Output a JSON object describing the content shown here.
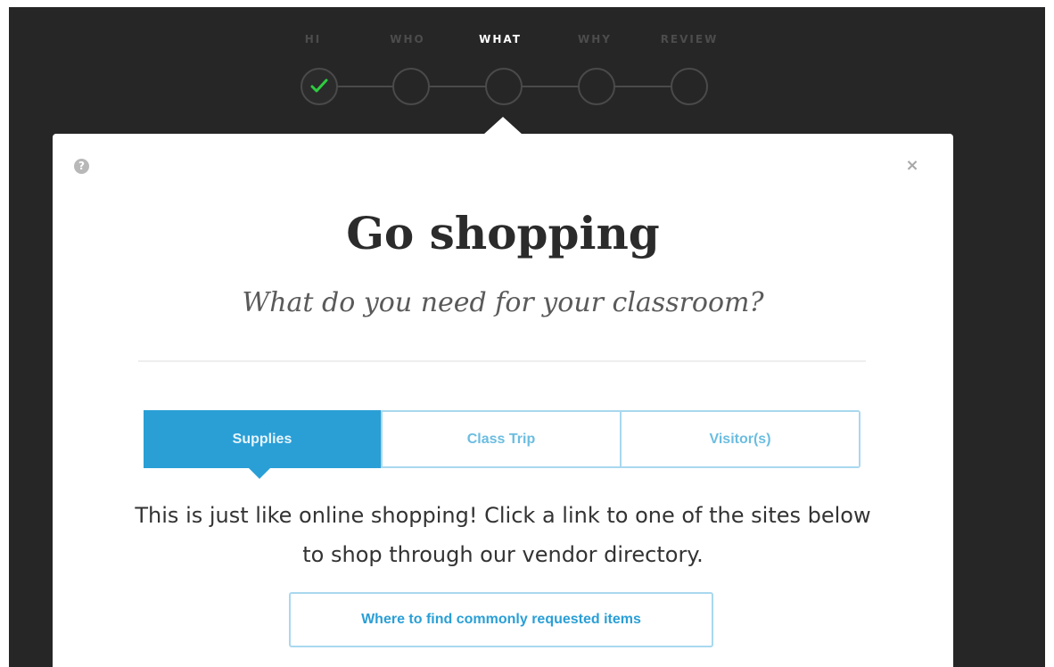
{
  "stepper": {
    "steps": [
      {
        "label": "HI",
        "state": "done"
      },
      {
        "label": "WHO",
        "state": "upcoming"
      },
      {
        "label": "WHAT",
        "state": "current"
      },
      {
        "label": "WHY",
        "state": "upcoming"
      },
      {
        "label": "REVIEW",
        "state": "upcoming"
      }
    ]
  },
  "modal": {
    "title": "Go shopping",
    "subtitle": "What do you need for your classroom?",
    "help_icon_glyph": "?",
    "close_icon_glyph": "×",
    "tabs": [
      {
        "label": "Supplies",
        "active": true
      },
      {
        "label": "Class Trip",
        "active": false
      },
      {
        "label": "Visitor(s)",
        "active": false
      }
    ],
    "description": "This is just like online shopping! Click a link to one of the sites below to shop through our vendor directory.",
    "link_button_label": "Where to find commonly requested items"
  },
  "colors": {
    "background": "#262626",
    "accent": "#2a9fd6",
    "check": "#2ecc40"
  }
}
